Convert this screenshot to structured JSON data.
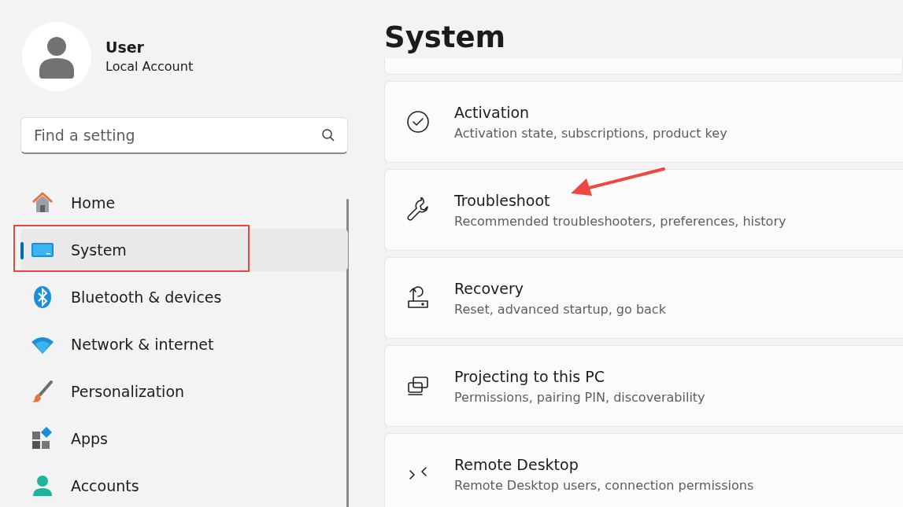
{
  "user": {
    "name": "User",
    "account": "Local Account"
  },
  "search": {
    "placeholder": "Find a setting"
  },
  "nav": [
    {
      "kind": "home",
      "label": "Home",
      "selected": false,
      "annotated": false
    },
    {
      "kind": "system",
      "label": "System",
      "selected": true,
      "annotated": true
    },
    {
      "kind": "bluetooth",
      "label": "Bluetooth & devices",
      "selected": false,
      "annotated": false
    },
    {
      "kind": "network",
      "label": "Network & internet",
      "selected": false,
      "annotated": false
    },
    {
      "kind": "personalization",
      "label": "Personalization",
      "selected": false,
      "annotated": false
    },
    {
      "kind": "apps",
      "label": "Apps",
      "selected": false,
      "annotated": false
    },
    {
      "kind": "accounts",
      "label": "Accounts",
      "selected": false,
      "annotated": false
    }
  ],
  "page_title": "System",
  "cards": [
    {
      "kind": "activation",
      "title": "Activation",
      "subtitle": "Activation state, subscriptions, product key",
      "arrow": false
    },
    {
      "kind": "troubleshoot",
      "title": "Troubleshoot",
      "subtitle": "Recommended troubleshooters, preferences, history",
      "arrow": true
    },
    {
      "kind": "recovery",
      "title": "Recovery",
      "subtitle": "Reset, advanced startup, go back",
      "arrow": false
    },
    {
      "kind": "projecting",
      "title": "Projecting to this PC",
      "subtitle": "Permissions, pairing PIN, discoverability",
      "arrow": false
    },
    {
      "kind": "remote",
      "title": "Remote Desktop",
      "subtitle": "Remote Desktop users, connection permissions",
      "arrow": false
    }
  ]
}
